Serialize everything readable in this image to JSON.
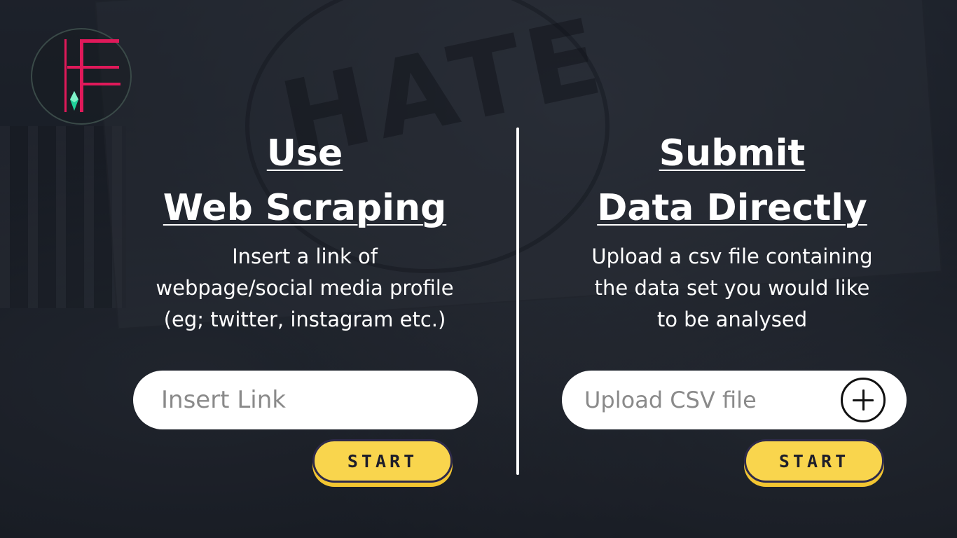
{
  "logo": {
    "icon": "hf-logo-icon",
    "accent_color": "#e0195a",
    "gem_color": "#1fd19a"
  },
  "left_panel": {
    "heading_line1": "Use",
    "heading_line2": "Web Scraping",
    "description_line1": "Insert a link of",
    "description_line2": "webpage/social media profile",
    "description_line3": "(eg; twitter, instagram etc.)",
    "input_placeholder": "Insert Link",
    "start_label": "START"
  },
  "right_panel": {
    "heading_line1": "Submit",
    "heading_line2": "Data Directly",
    "description_line1": "Upload a csv file containing",
    "description_line2": "the data set you would like",
    "description_line3": "to be analysed",
    "input_placeholder": "Upload CSV file",
    "upload_icon": "plus-circle-icon",
    "start_label": "START"
  },
  "colors": {
    "button_yellow": "#f9d54d",
    "button_border": "#2e2a4a",
    "background": "#1f2530"
  }
}
